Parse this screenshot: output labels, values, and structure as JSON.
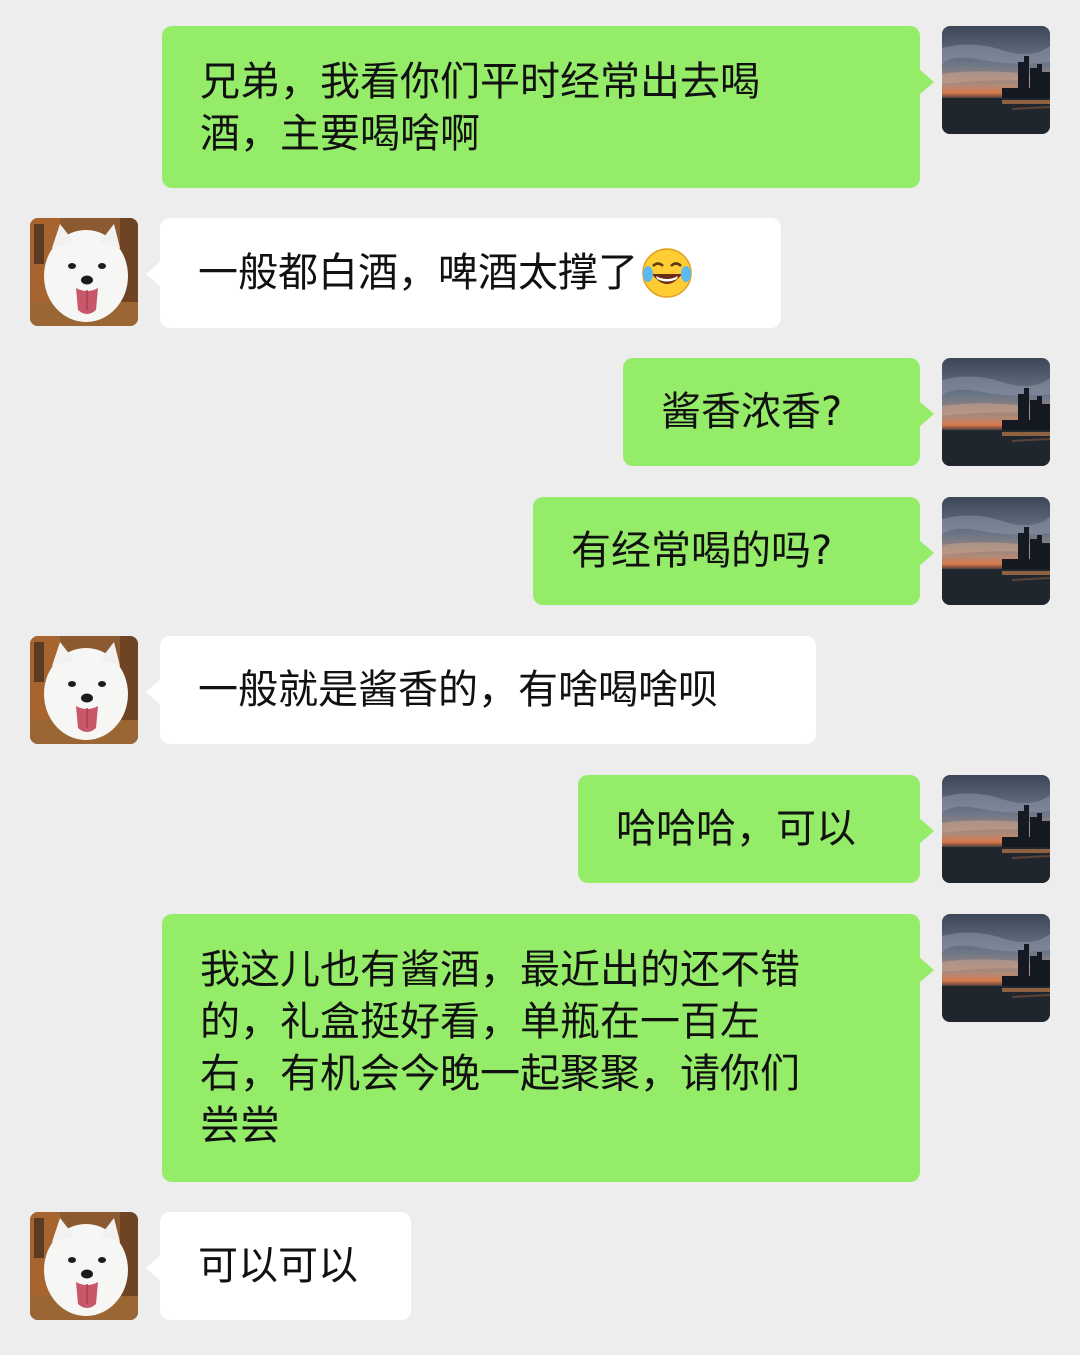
{
  "messages": [
    {
      "sender": "me",
      "text": "兄弟，我看你们平时经常出去喝\n酒，主要喝啥啊"
    },
    {
      "sender": "friend",
      "text": "一般都白酒，啤酒太撑了",
      "emoji": "tears-of-joy-emoji"
    },
    {
      "sender": "me",
      "text": "酱香浓香?"
    },
    {
      "sender": "me",
      "text": "有经常喝的吗?"
    },
    {
      "sender": "friend",
      "text": "一般就是酱香的，有啥喝啥呗"
    },
    {
      "sender": "me",
      "text": "哈哈哈，可以"
    },
    {
      "sender": "me",
      "text": "我这儿也有酱酒，最近出的还不错\n的，礼盒挺好看，单瓶在一百左\n右，有机会今晚一起聚聚，请你们\n尝尝"
    },
    {
      "sender": "friend",
      "text": "可以可以"
    }
  ],
  "colors": {
    "background": "#ededed",
    "my_bubble": "#95ec69",
    "friend_bubble": "#ffffff"
  },
  "icons": {
    "my_avatar": "city-skyline-sunset-avatar",
    "friend_avatar": "samoyed-dog-avatar"
  }
}
